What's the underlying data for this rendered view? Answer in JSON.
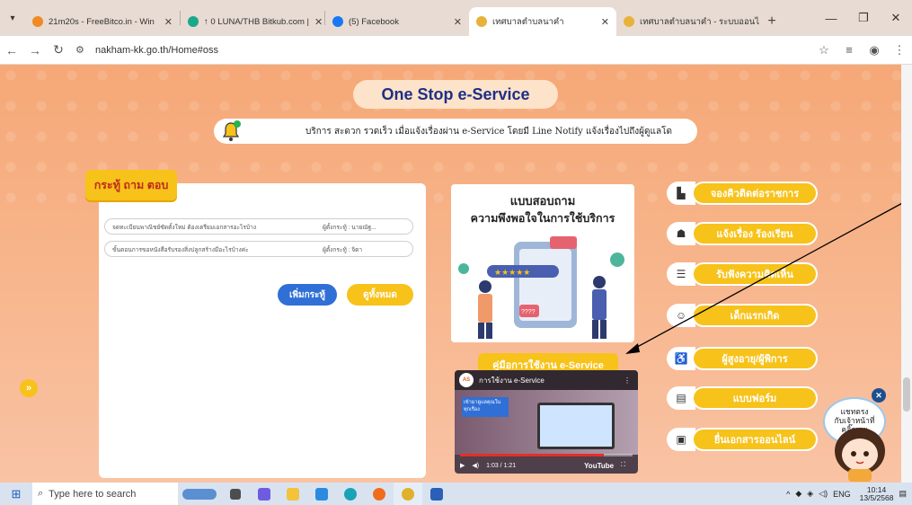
{
  "browser": {
    "tabs": [
      {
        "label": "21m20s - FreeBitco.in - Win",
        "color": "#f08a24",
        "active": false
      },
      {
        "label": "↑ 0 LUNA/THB Bitkub.com |",
        "color": "#1aa88a",
        "active": false
      },
      {
        "label": "(5) Facebook",
        "color": "#1877f2",
        "active": false
      },
      {
        "label": "เทศบาลตำบลนาคำ",
        "color": "#e8b23a",
        "active": true
      },
      {
        "label": "เทศบาลตำบลนาคำ - ระบบออนไ",
        "color": "#e8b23a",
        "active": false
      }
    ],
    "new_tab": "+",
    "url": "nakham-kk.go.th/Home#oss"
  },
  "page": {
    "title": "One Stop e-Service",
    "notice": "บริการ สะดวก รวดเร็ว เมื่อแจ้งเรื่องผ่าน e-Service โดยมี Line Notify แจ้งเรื่องไปถึงผู้ดูแลโด",
    "qa": {
      "label": "กระทู้ ถาม ตอบ",
      "rows": [
        {
          "question": "จดทะเบียนพาณิชย์ซัดตั้งใหม่ ต้องเตรียมเอกสารอะไรบ้าง",
          "author": "ผู้ตั้งกระทู้ : นายณัฐ..."
        },
        {
          "question": "ขั้นตอนการขอหนังสือรับรองสิ่งปลูกสร้างมีอะไรบ้างค่ะ",
          "author": "ผู้ตั้งกระทู้ : จิดา"
        }
      ],
      "add_button": "เพิ่มกระทู้",
      "all_button": "ดูทั้งหมด"
    },
    "survey": {
      "line1": "แบบสอบถาม",
      "line2": "ความพึงพอใจในการใช้บริการ"
    },
    "manual_label": "คู่มือการใช้งาน e-Service",
    "video": {
      "title": "การใช้งาน e-Service",
      "card_text": "เข้ามาดูแลคุณในทุกเรื่อง",
      "time": "1:03 / 1:21",
      "platform": "YouTube"
    },
    "services": [
      {
        "label": "จองคิวติดต่อราชการ",
        "icon": "queue-icon"
      },
      {
        "label": "แจ้งเรื่อง ร้องเรียน",
        "icon": "complaint-icon"
      },
      {
        "label": "รับฟังความคิดเห็น",
        "icon": "feedback-icon"
      },
      {
        "label": "เด็กแรกเกิด",
        "icon": "baby-icon"
      },
      {
        "label": "ผู้สูงอายุ/ผู้พิการ",
        "icon": "elderly-icon"
      },
      {
        "label": "แบบฟอร์ม",
        "icon": "form-icon"
      },
      {
        "label": "ยื่นเอกสารออนไลน์",
        "icon": "document-icon"
      }
    ],
    "chat": {
      "line1": "แชทตรง",
      "line2": "กับเจ้าหน้าที่",
      "line3": "คลิ๊กเลย"
    }
  },
  "taskbar": {
    "search_placeholder": "Type here to search",
    "lang": "ENG",
    "time": "10:14",
    "date": "13/5/2568"
  },
  "colors": {
    "accent_yellow": "#f7c21a",
    "title_blue": "#1e2f86",
    "button_blue": "#2f6fd6",
    "page_orange": "#f6a877"
  }
}
